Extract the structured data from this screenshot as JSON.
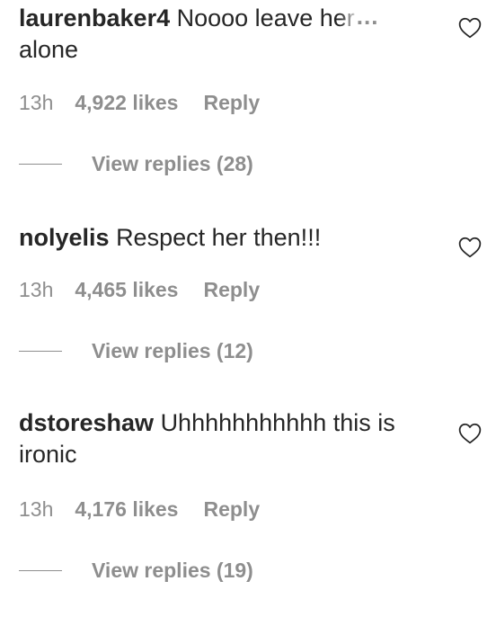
{
  "comments": [
    {
      "username": "laurenbaker4",
      "text_visible": "Noooo leave h",
      "text_faded": "er",
      "text_cont": "alone",
      "more": "...",
      "time": "13h",
      "likes": "4,922 likes",
      "reply": "Reply",
      "view_replies": "View replies (28)"
    },
    {
      "username": "nolyelis",
      "text": "Respect her then!!!",
      "time": "13h",
      "likes": "4,465 likes",
      "reply": "Reply",
      "view_replies": "View replies (12)"
    },
    {
      "username": "dstoreshaw",
      "text": "Uhhhhhhhhhhh this is ironic",
      "time": "13h",
      "likes": "4,176 likes",
      "reply": "Reply",
      "view_replies": "View replies (19)"
    }
  ],
  "icons": {
    "heart": "heart-outline-icon"
  },
  "colors": {
    "text": "#262626",
    "secondary": "#8e8e8e",
    "background": "#ffffff"
  }
}
